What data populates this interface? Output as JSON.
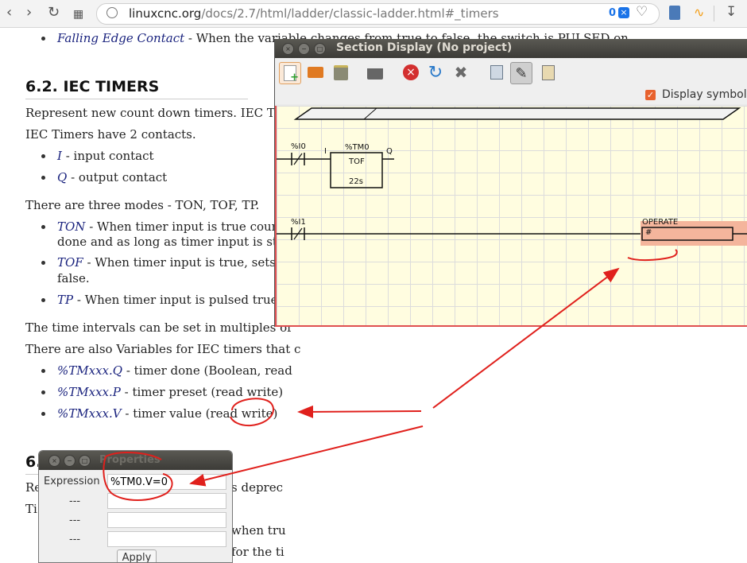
{
  "browser": {
    "url_host": "linuxcnc.org",
    "url_path": "/docs/2.7/html/ladder/classic-ladder.html#_timers",
    "badge_count": "0",
    "back_icon": "back-icon",
    "reload_icon": "reload-icon"
  },
  "doc": {
    "top_item_term": "Falling Edge Contact",
    "top_item_text": " - When the variable changes from true to false, the switch is PULSED on.",
    "section_heading": "6.2. IEC TIMERS",
    "p1": "Represent new count down timers. IEC Time",
    "p2": "IEC Timers have 2 contacts.",
    "contacts": [
      {
        "term": "I",
        "text": " - input contact"
      },
      {
        "term": "Q",
        "text": " - output contact"
      }
    ],
    "modes_intro": "There are three modes - TON, TOF, TP.",
    "modes": [
      {
        "term": "TON",
        "line1": " - When timer input is true countd",
        "line2": "done and as long as timer input is still t"
      },
      {
        "term": "TOF",
        "line1": " - When timer input is true, sets ou",
        "line2": "false."
      },
      {
        "term": "TP",
        "line1": " - When timer input is pulsed true or",
        "line2": ""
      }
    ],
    "p_intervals": "The time intervals can be set in multiples of",
    "p_vars": "There are also Variables for IEC timers that c",
    "vars": [
      {
        "term": "%TMxxx.Q",
        "text": " - timer done (Boolean, read"
      },
      {
        "term": "%TMxxx.P",
        "text": " - timer preset (read write)"
      },
      {
        "term": "%TMxxx.V",
        "text": " - timer value (read write)"
      }
    ],
    "next_heading_prefix": "6.",
    "frag_re": "Re",
    "frag_s_deprec": "s deprec",
    "frag_ti": "Ti",
    "frag_when_tru": "when tru",
    "frag_for_the_ti": "for the ti"
  },
  "section_window": {
    "title": "Section Display (No project)",
    "display_symbols_label": "Display symbols",
    "display_symbols_checked": true,
    "toolbar": [
      "new-section-icon",
      "open-icon",
      "save-icon",
      "print-icon",
      "delete-icon",
      "refresh-icon",
      "tools-icon",
      "copy-icon",
      "edit-pencil-icon",
      "paste-icon"
    ]
  },
  "ladder": {
    "rung1": {
      "contact": "%I0",
      "input_label": "I",
      "timer_name": "%TM0",
      "timer_mode": "TOF",
      "timer_preset": "22s",
      "output_label": "Q"
    },
    "rung2": {
      "contact": "%I1",
      "operate_label": "OPERATE",
      "operate_value": "#"
    }
  },
  "properties": {
    "title": "Properties",
    "rows": [
      {
        "label": "Expression",
        "value": "%TM0.V=0"
      },
      {
        "label": "---",
        "value": ""
      },
      {
        "label": "---",
        "value": ""
      },
      {
        "label": "---",
        "value": ""
      }
    ],
    "apply_label": "Apply"
  },
  "colors": {
    "annotation": "#e0201c",
    "link_term": "#1a237e",
    "ladder_bg": "#fffde0",
    "operate_highlight": "#f4b59c"
  }
}
